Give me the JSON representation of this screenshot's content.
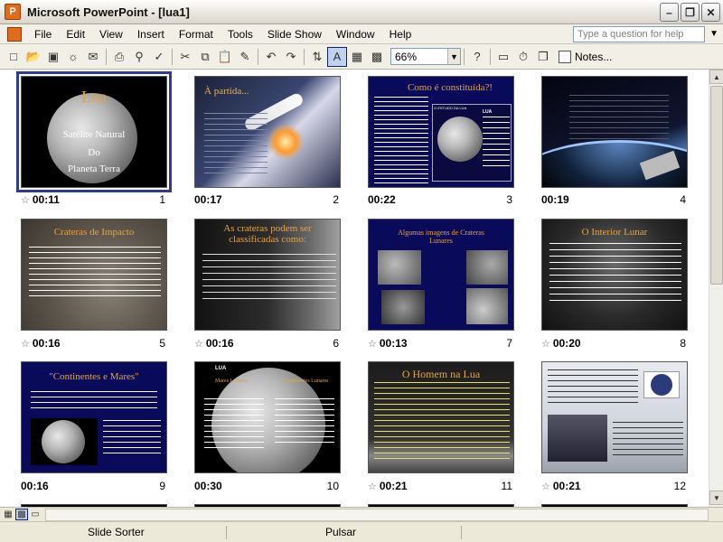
{
  "window": {
    "title": "Microsoft PowerPoint - [lua1]",
    "app_icon": "powerpoint-icon"
  },
  "menu": {
    "items": [
      "File",
      "Edit",
      "View",
      "Insert",
      "Format",
      "Tools",
      "Slide Show",
      "Window",
      "Help"
    ],
    "help_placeholder": "Type a question for help"
  },
  "toolbar": {
    "zoom": "66%",
    "notes_label": "Notes..."
  },
  "slides": [
    {
      "number": "1",
      "time": "00:11",
      "title": "Lua",
      "lines": [
        "Satélite Natural",
        "Do",
        "Planeta Terra"
      ],
      "bg": "#000000"
    },
    {
      "number": "2",
      "time": "00:17",
      "title": "À partida...",
      "bg": "#20263a"
    },
    {
      "number": "3",
      "time": "00:22",
      "title": "Como é constituída?!",
      "box_title": "LUA",
      "caption": "O ESTUDO DA LUA",
      "bg": "#0a0a5a"
    },
    {
      "number": "4",
      "time": "00:19",
      "title": "",
      "bg": "#0a0a14"
    },
    {
      "number": "5",
      "time": "00:16",
      "title": "Crateras de Impacto",
      "bg": "#5c554c"
    },
    {
      "number": "6",
      "time": "00:16",
      "title": "As crateras podem ser classificadas como:",
      "bg": "#1a1a1a"
    },
    {
      "number": "7",
      "time": "00:13",
      "title": "Algumas imagens de Crateras Lunares",
      "bg": "#0a0a5a"
    },
    {
      "number": "8",
      "time": "00:20",
      "title": "O Interior Lunar",
      "bg": "#202020"
    },
    {
      "number": "9",
      "time": "00:16",
      "title": "\"Continentes e Mares\"",
      "bg": "#0a0a5a"
    },
    {
      "number": "10",
      "time": "00:30",
      "title": "LUA",
      "left_label": "Mares Lunares",
      "right_label": "Continentes Lunares",
      "bg": "#000000"
    },
    {
      "number": "11",
      "time": "00:21",
      "title": "O Homem na Lua",
      "bg": "#1c1c1c"
    },
    {
      "number": "12",
      "time": "00:21",
      "title": "",
      "bg": "#e8e8e8"
    }
  ],
  "status": {
    "view": "Slide Sorter",
    "design": "Pulsar"
  }
}
